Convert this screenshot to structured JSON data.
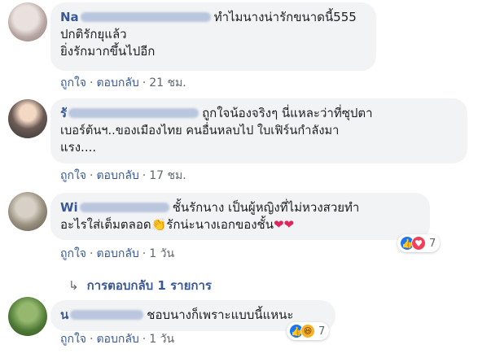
{
  "comments": [
    {
      "author_visible": "Na",
      "text_lines": [
        "ทำไมนางน่ารักขนาดนี้555",
        "ปกติรักยุแล้ว",
        "ยิ่งรักมากขึ้นไปอีก"
      ],
      "actions": {
        "like": "ถูกใจ",
        "reply": "ตอบกลับ",
        "time": "21 ชม."
      }
    },
    {
      "author_visible": "รั",
      "text_lines": [
        "ถูกใจน้องจริงๆ นี่แหละว่าที่ซุปตา",
        "เบอร์ต้นฯ..ของเมืองไทย คนอื่นหลบไป ใบเฟิร์นกำลังมา",
        "แรง...."
      ],
      "actions": {
        "like": "ถูกใจ",
        "reply": "ตอบกลับ",
        "time": "17 ชม."
      }
    },
    {
      "author_visible": "Wi",
      "text_lines": [
        "ชั้นรักนาง เป็นผู้หญิงที่ไม่หวงสวยทำ",
        "อะไรใส่เต็มตลอด",
        "รักน่ะนางเอกของชั้น"
      ],
      "emoji_clap": "👏",
      "emoji_hearts": "❤❤",
      "actions": {
        "like": "ถูกใจ",
        "reply": "ตอบกลับ",
        "time": "1 วัน"
      },
      "reaction_count": "7",
      "replies_label": "การตอบกลับ 1 รายการ"
    },
    {
      "author_visible": "น",
      "text_lines": [
        "ชอบนางก็เพราะแบบนี้แหนะ"
      ],
      "actions": {
        "like": "ถูกใจ",
        "reply": "ตอบกลับ",
        "time": "1 วัน"
      },
      "reaction_count": "7"
    }
  ],
  "icons": {
    "like": "👍",
    "love": "♥",
    "haha": "😆",
    "reply_arrow": "↳"
  },
  "colors": {
    "link": "#385898",
    "bubble": "#f2f3f5",
    "meta": "#606770"
  }
}
